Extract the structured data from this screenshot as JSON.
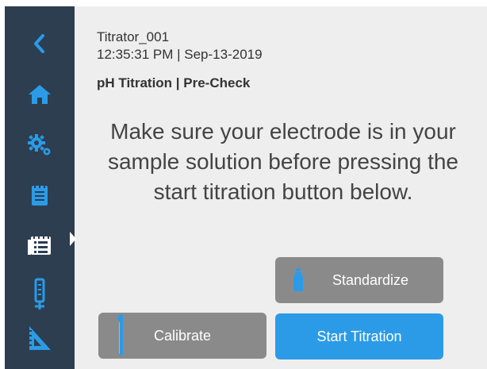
{
  "sidebar": {
    "items": [
      {
        "name": "back",
        "icon": "chevron-left-icon"
      },
      {
        "name": "home",
        "icon": "home-icon"
      },
      {
        "name": "settings",
        "icon": "gears-icon"
      },
      {
        "name": "notes",
        "icon": "notepad-icon"
      },
      {
        "name": "methods",
        "icon": "list-icon",
        "active": true
      },
      {
        "name": "electrode",
        "icon": "electrode-icon"
      },
      {
        "name": "measure",
        "icon": "triangle-ruler-icon"
      }
    ],
    "icon_color": "#2b9be7",
    "active_icon_color": "#ffffff",
    "background": "#2d3e50"
  },
  "header": {
    "device_name": "Titrator_001",
    "timestamp": "12:35:31 PM | Sep-13-2019",
    "breadcrumb": "pH Titration | Pre-Check"
  },
  "message": "Make sure your electrode is in your sample solution before pressing the start titration button below.",
  "buttons": {
    "standardize": "Standardize",
    "calibrate": "Calibrate",
    "start_titration": "Start Titration"
  },
  "colors": {
    "primary": "#2b9be7",
    "disabled": "#8a8a8a",
    "background": "#eeeeee",
    "text": "#444444"
  }
}
